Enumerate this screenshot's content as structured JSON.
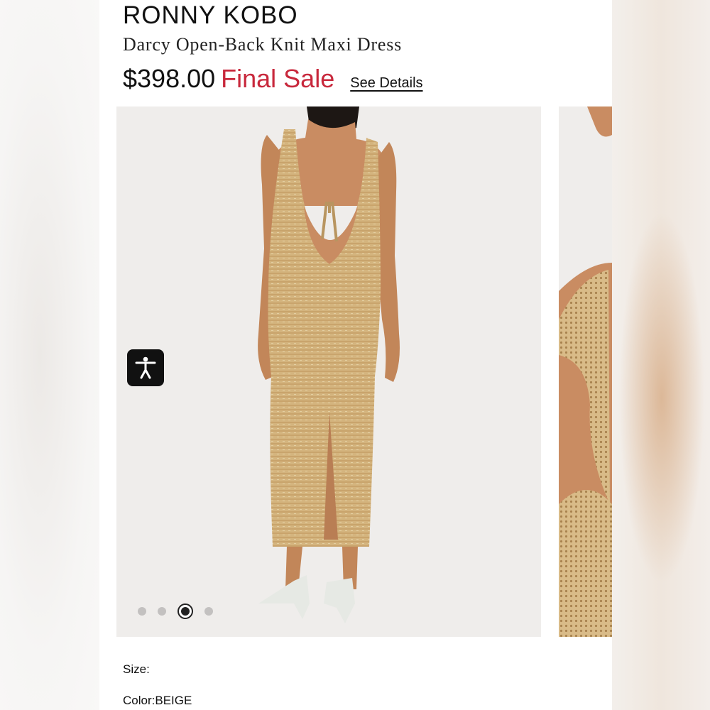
{
  "product": {
    "brand": "RONNY KOBO",
    "name": "Darcy Open-Back Knit Maxi Dress",
    "price": "$398.00",
    "sale_label": "Final Sale",
    "details_link": "See Details"
  },
  "gallery": {
    "image_count": 4,
    "active_index": 2,
    "main_image_icon": "dress-back-view",
    "next_image_icon": "dress-detail-crop"
  },
  "accessibility": {
    "icon": "accessibility-icon"
  },
  "options": {
    "size_label": "Size:",
    "color_label": "Color:",
    "color_value": "BEIGE"
  },
  "colors": {
    "sale": "#c8283c",
    "dress": "#d2b27d",
    "background_photo": "#efedeb"
  }
}
